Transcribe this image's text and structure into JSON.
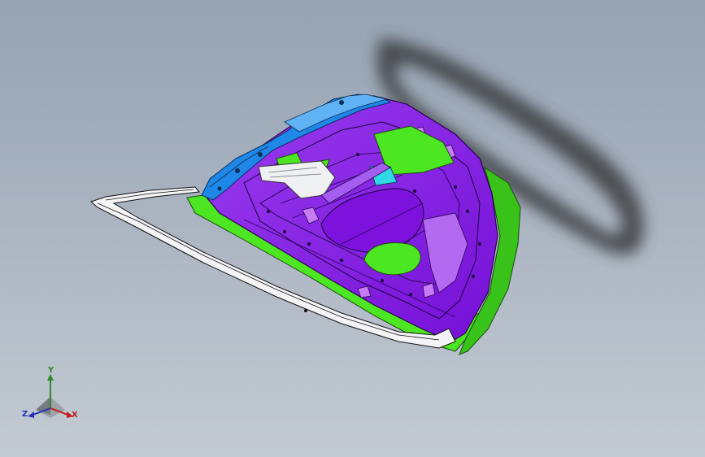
{
  "viewport": {
    "background_top": "#96a3b3",
    "background_bottom": "#c3cad3"
  },
  "model": {
    "colors": {
      "inner_panel": "#8a16e8",
      "inner_panel_light": "#b46af0",
      "trim_surface": "#4de622",
      "hinge_bracket": "#1f87e8",
      "frame_rail": "#f4f4f6",
      "cyan_surface": "#2fd8e6"
    }
  },
  "triad": {
    "axes": {
      "y": "Y",
      "z": "Z",
      "x": "X"
    },
    "colors": {
      "y": "#2d8a2d",
      "z": "#2433b4",
      "x": "#c21d1d"
    }
  }
}
